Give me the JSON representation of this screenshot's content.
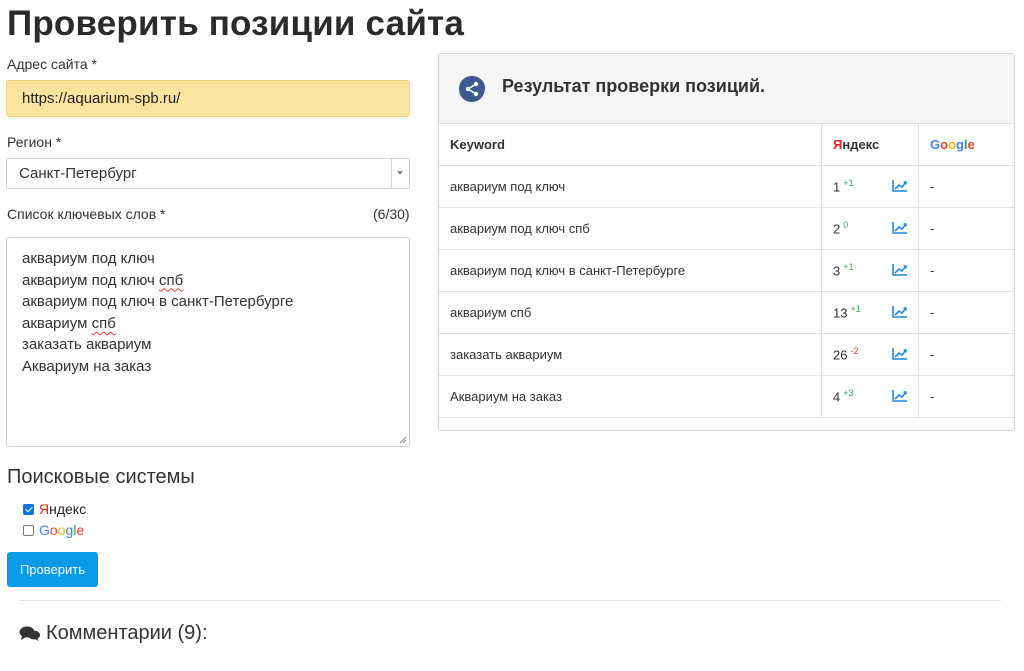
{
  "page": {
    "title": "Проверить позиции сайта"
  },
  "form": {
    "url_label": "Адрес сайта *",
    "url_value": "https://aquarium-spb.ru/",
    "region_label": "Регион *",
    "region_value": "Санкт-Петербург",
    "keywords_label": "Список ключевых слов *",
    "keywords_count": "(6/30)",
    "keywords": [
      "аквариум под ключ",
      "аквариум под ключ спб",
      "аквариум под ключ в санкт-Петербурге",
      "аквариум спб",
      "заказать аквариум",
      "Аквариум на заказ"
    ],
    "search_engines_title": "Поисковые системы",
    "engines": [
      {
        "label": "Яндекс",
        "checked": true
      },
      {
        "label": "Google",
        "checked": false
      }
    ],
    "submit_label": "Проверить"
  },
  "comments": {
    "title": "Комментарии (9):"
  },
  "results": {
    "title": "Результат проверки позиций.",
    "columns": {
      "keyword": "Keyword",
      "yandex": "Яндекс",
      "google": "Google"
    },
    "rows": [
      {
        "keyword": "аквариум под ключ",
        "yandex_pos": "1",
        "yandex_delta": "+1",
        "delta_type": "up",
        "google": "-"
      },
      {
        "keyword": "аквариум под ключ спб",
        "yandex_pos": "2",
        "yandex_delta": "0",
        "delta_type": "zero",
        "google": "-"
      },
      {
        "keyword": "аквариум под ключ в санкт-Петербурге",
        "yandex_pos": "3",
        "yandex_delta": "+1",
        "delta_type": "up",
        "google": "-"
      },
      {
        "keyword": "аквариум спб",
        "yandex_pos": "13",
        "yandex_delta": "+1",
        "delta_type": "up",
        "google": "-"
      },
      {
        "keyword": "заказать аквариум",
        "yandex_pos": "26",
        "yandex_delta": "-2",
        "delta_type": "down",
        "google": "-"
      },
      {
        "keyword": "Аквариум на заказ",
        "yandex_pos": "4",
        "yandex_delta": "+3",
        "delta_type": "up",
        "google": "-"
      }
    ]
  },
  "colors": {
    "url_input_bg": "#fce39e",
    "button_bg": "#0b9be6",
    "yandex_red": "#e5201f",
    "delta_up": "#3aa757",
    "delta_down": "#e03c3c",
    "chart_icon": "#1e8bdc",
    "share_icon_bg": "#3e5b8f"
  },
  "icons": {
    "share": "share-icon",
    "chart": "chart-line-icon",
    "comments": "comments-icon",
    "select_arrow": "caret-down-icon"
  }
}
